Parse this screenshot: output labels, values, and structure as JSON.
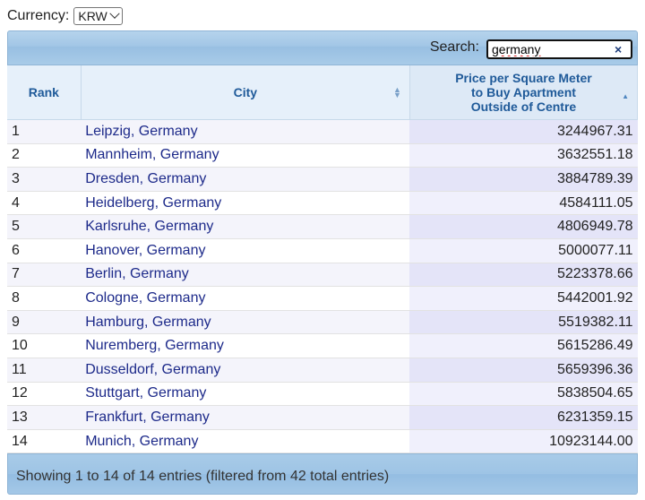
{
  "currency": {
    "label": "Currency:",
    "selected": "KRW"
  },
  "search": {
    "label": "Search:",
    "value": "germany",
    "clear_glyph": "×"
  },
  "columns": [
    {
      "label": "Rank"
    },
    {
      "label": "City"
    },
    {
      "label": "Price per Square Meter to Buy Apartment Outside of Centre",
      "lines": [
        "Price per Square Meter",
        "to Buy Apartment",
        "Outside of Centre"
      ]
    }
  ],
  "rows": [
    {
      "rank": "1",
      "city": "Leipzig, Germany",
      "price": "3244967.31"
    },
    {
      "rank": "2",
      "city": "Mannheim, Germany",
      "price": "3632551.18"
    },
    {
      "rank": "3",
      "city": "Dresden, Germany",
      "price": "3884789.39"
    },
    {
      "rank": "4",
      "city": "Heidelberg, Germany",
      "price": "4584111.05"
    },
    {
      "rank": "5",
      "city": "Karlsruhe, Germany",
      "price": "4806949.78"
    },
    {
      "rank": "6",
      "city": "Hanover, Germany",
      "price": "5000077.11"
    },
    {
      "rank": "7",
      "city": "Berlin, Germany",
      "price": "5223378.66"
    },
    {
      "rank": "8",
      "city": "Cologne, Germany",
      "price": "5442001.92"
    },
    {
      "rank": "9",
      "city": "Hamburg, Germany",
      "price": "5519382.11"
    },
    {
      "rank": "10",
      "city": "Nuremberg, Germany",
      "price": "5615286.49"
    },
    {
      "rank": "11",
      "city": "Dusseldorf, Germany",
      "price": "5659396.36"
    },
    {
      "rank": "12",
      "city": "Stuttgart, Germany",
      "price": "5838504.65"
    },
    {
      "rank": "13",
      "city": "Frankfurt, Germany",
      "price": "6231359.15"
    },
    {
      "rank": "14",
      "city": "Munich, Germany",
      "price": "10923144.00"
    }
  ],
  "footer": {
    "info": "Showing 1 to 14 of 14 entries (filtered from 42 total entries)"
  },
  "colors": {
    "header_text": "#1f5a99",
    "link": "#1d2a8a",
    "bar": "#a2c6e6"
  }
}
